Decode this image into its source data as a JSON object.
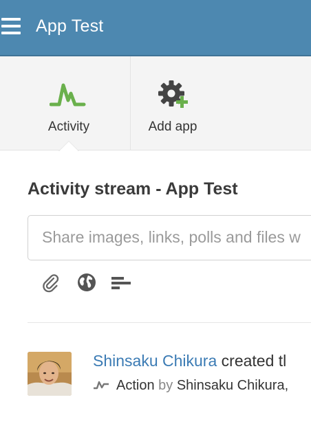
{
  "header": {
    "title": "App Test",
    "bar_color": "#4d88b0",
    "menu_icon": "hamburger-menu-icon"
  },
  "tabs": [
    {
      "label": "Activity",
      "icon": "activity-pulse-icon",
      "active": true,
      "icon_color": "#6ab04c"
    },
    {
      "label": "Add app",
      "icon": "gear-plus-icon",
      "active": false,
      "plus_color": "#6ab04c"
    }
  ],
  "stream": {
    "title": "Activity stream - App Test",
    "share_placeholder": "Share images, links, polls and files w",
    "tools": [
      {
        "icon": "paperclip-icon"
      },
      {
        "icon": "globe-icon"
      },
      {
        "icon": "poll-icon"
      }
    ]
  },
  "feed": [
    {
      "author": "Shinsaku Chikura",
      "verb": " created tl",
      "action_icon": "activity-pulse-icon",
      "type_label": "Action",
      "by_label": " by ",
      "by_author": "Shinsaku Chikura,",
      "link_color": "#3b7bb4"
    }
  ]
}
